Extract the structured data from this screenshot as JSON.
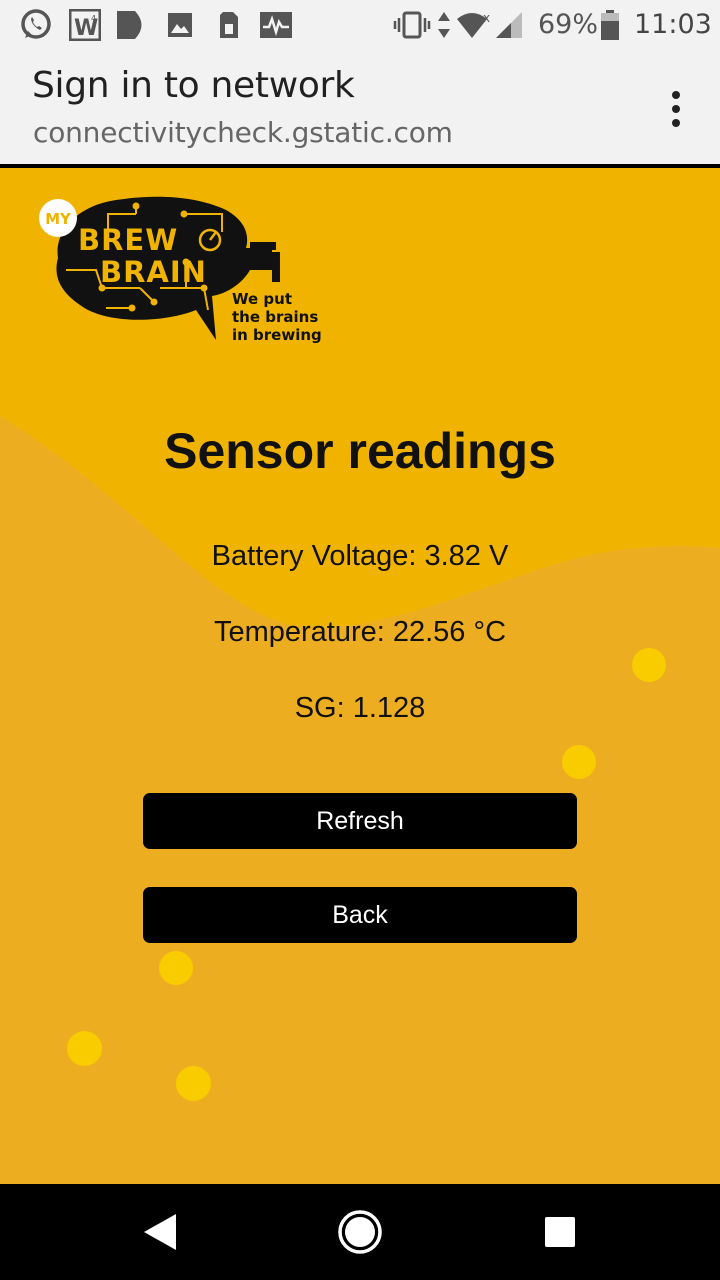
{
  "status_bar": {
    "battery_percent": "69%",
    "time": "11:03",
    "notification_icons": [
      "whatsapp-icon",
      "word-icon",
      "maps-icon",
      "image-icon",
      "sim-icon",
      "activity-icon"
    ],
    "system_icons": [
      "vibrate-icon",
      "data-arrows-icon",
      "wifi-icon",
      "signal-icon",
      "battery-icon"
    ]
  },
  "app_bar": {
    "title": "Sign in to network",
    "url": "connectivitycheck.gstatic.com",
    "menu_icon": "more-vert-icon"
  },
  "logo": {
    "my": "MY",
    "brew": "BREW",
    "brain": "BRAIN",
    "tagline_1": "We put",
    "tagline_2": "the brains",
    "tagline_3": "in brewing"
  },
  "main": {
    "heading": "Sensor readings",
    "battery": "Battery Voltage: 3.82 V",
    "temperature": "Temperature: 22.56 °C",
    "sg": "SG: 1.128",
    "refresh_label": "Refresh",
    "back_label": "Back"
  },
  "colors": {
    "background": "#f0b400",
    "wave": "#edad20",
    "bubble": "#f9cc00",
    "button": "#000000"
  },
  "nav_bar": {
    "icons": [
      "back-icon",
      "home-icon",
      "recents-icon"
    ]
  }
}
